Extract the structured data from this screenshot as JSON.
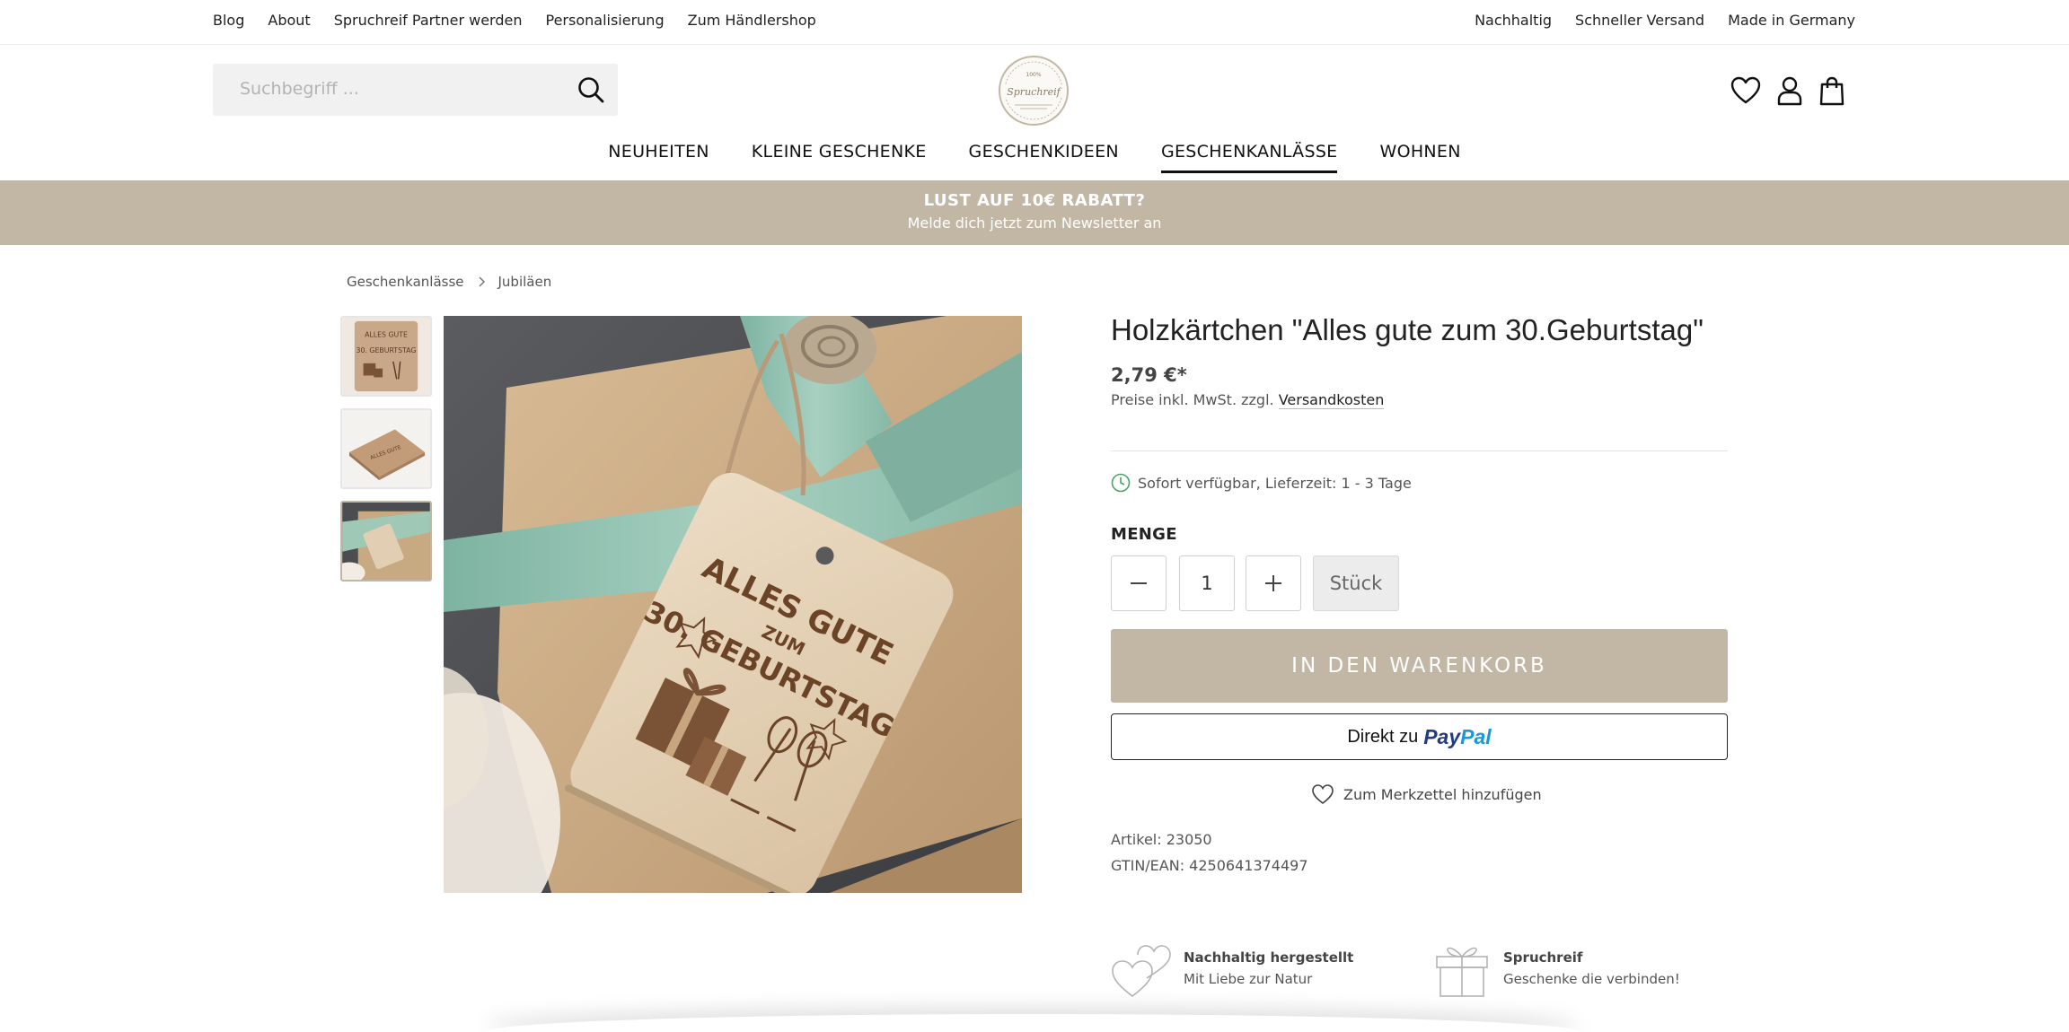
{
  "topbar": {
    "left_links": [
      "Blog",
      "About",
      "Spruchreif Partner werden",
      "Personalisierung",
      "Zum Händlershop"
    ],
    "right_links": [
      "Nachhaltig",
      "Schneller Versand",
      "Made in Germany"
    ]
  },
  "search": {
    "placeholder": "Suchbegriff ..."
  },
  "logo": {
    "top_text": "100%",
    "brand": "Spruchreif"
  },
  "main_nav": [
    "NEUHEITEN",
    "KLEINE GESCHENKE",
    "GESCHENKIDEEN",
    "GESCHENKANLÄSSE",
    "WOHNEN"
  ],
  "promo": {
    "headline": "LUST AUF 10€ RABATT?",
    "subline": "Melde dich jetzt zum Newsletter an"
  },
  "breadcrumb": [
    "Geschenkanlässe",
    "Jubiläen"
  ],
  "product": {
    "title": "Holzkärtchen \"Alles gute zum 30.Geburtstag\"",
    "price": "2,79 €*",
    "tax_prefix": "Preise inkl. MwSt. zzgl.",
    "tax_link": "Versandkosten",
    "availability": "Sofort verfügbar, Lieferzeit: 1 - 3 Tage",
    "quantity_label": "MENGE",
    "quantity_value": "1",
    "unit": "Stück",
    "add_to_cart": "IN DEN WARENKORB",
    "paypal_prefix": "Direkt zu",
    "paypal_pay": "Pay",
    "paypal_pal": "Pal",
    "wishlist": "Zum Merkzettel hinzufügen",
    "article": "Artikel: 23050",
    "gtin": "GTIN/EAN: 4250641374497"
  },
  "tag_engraving": {
    "line1": "ALLES GUTE",
    "line2": "ZUM",
    "line3": "30. GEBURTSTAG"
  },
  "features": [
    {
      "title": "Nachhaltig hergestellt",
      "subtitle": "Mit Liebe zur Natur"
    },
    {
      "title": "Spruchreif",
      "subtitle": "Geschenke die verbinden!"
    }
  ],
  "colors": {
    "accent": "#c2b6a5",
    "text": "#222222",
    "avail_green": "#4aa35e"
  }
}
